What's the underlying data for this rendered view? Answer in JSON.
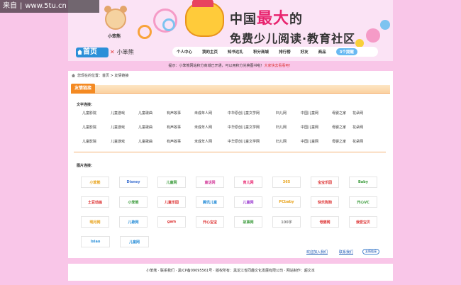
{
  "watermark": {
    "part1": "来自",
    "part2": "www.5tu.cn"
  },
  "header": {
    "logo_name": "小笨熊",
    "slogan_part1": "中国",
    "slogan_highlight": "最大",
    "slogan_part2": "的",
    "slogan_line2": "免费少儿阅读·教育社区"
  },
  "nav": {
    "home_label": "首页",
    "user_name": "小笨熊",
    "items": [
      "个人中心",
      "我的主页",
      "知书达礼",
      "积分商城",
      "排行榜",
      "好友",
      "商品",
      "3个提醒"
    ]
  },
  "tip": {
    "text": "提示：小笨熊网站积分商城已开通，可以用积分兑换图书啦！",
    "link": "大家快去看看吧！"
  },
  "breadcrumb": "您现在的位置：首页 > 友情链接",
  "section_title": "友情链接",
  "text_links_label": "文字连接：",
  "text_links_rows": [
    [
      "儿童影院",
      "儿童游戏",
      "儿童歌曲",
      "有声故事",
      "未成年人网",
      "中华原创儿童文学网",
      "妇儿网",
      "中国儿童网",
      "母婴之家",
      "花朵网"
    ],
    [
      "儿童影院",
      "儿童游戏",
      "儿童歌曲",
      "有声故事",
      "未成年人网",
      "中华原创儿童文学网",
      "妇儿网",
      "中国儿童网",
      "母婴之家",
      "花朵网"
    ],
    [
      "儿童影院",
      "儿童游戏",
      "儿童歌曲",
      "有声故事",
      "未成年人网",
      "中华原创儿童文学网",
      "妇儿网",
      "中国儿童网",
      "母婴之家",
      "花朵网"
    ]
  ],
  "image_links_label": "图片连接：",
  "logo_rows": [
    [
      {
        "text": "小笨熊",
        "color": "#e8a21a"
      },
      {
        "text": "Disney",
        "color": "#3b6fd0"
      },
      {
        "text": "儿童网",
        "color": "#3b9b3b"
      },
      {
        "text": "童话网",
        "color": "#d33d9b"
      },
      {
        "text": "育儿网",
        "color": "#e8236e"
      },
      {
        "text": "365",
        "color": "#e8a21a"
      },
      {
        "text": "宝宝乐园",
        "color": "#d33"
      },
      {
        "text": "Baby",
        "color": "#3b9b3b"
      }
    ],
    [
      {
        "text": "土豆动画",
        "color": "#d33"
      },
      {
        "text": "小笨熊",
        "color": "#3b9b3b"
      },
      {
        "text": "儿童乐园",
        "color": "#d33"
      },
      {
        "text": "腾讯儿童",
        "color": "#2b8fd8"
      },
      {
        "text": "儿童网",
        "color": "#9b3bd0"
      },
      {
        "text": "PCbaby",
        "color": "#e8a21a"
      },
      {
        "text": "快乐狗狗",
        "color": "#d33"
      },
      {
        "text": "开心VC",
        "color": "#3b9b3b"
      }
    ],
    [
      {
        "text": "明月网",
        "color": "#e8a21a"
      },
      {
        "text": "儿歌网",
        "color": "#2b8fd8"
      },
      {
        "text": "gam",
        "color": "#d33"
      },
      {
        "text": "开心宝宝",
        "color": "#d33"
      },
      {
        "text": "故事网",
        "color": "#3b9b3b"
      },
      {
        "text": "100字",
        "color": "#888"
      },
      {
        "text": "母婴网",
        "color": "#d33"
      },
      {
        "text": "我爱宝贝",
        "color": "#d33"
      }
    ],
    [
      {
        "text": "Ixiao",
        "color": "#2b8fd8"
      },
      {
        "text": "儿童网",
        "color": "#2b8fd8"
      }
    ]
  ],
  "apply_link": "欢迎加入我们",
  "contact_link": "联系我们",
  "link_tag": "友情链接",
  "footer": "小笨熊 · 联系我们 · 黑ICP备09095561号 · 版权所有：黑龙江省同趣文化发展有限公司 · 网站制作：超文本"
}
